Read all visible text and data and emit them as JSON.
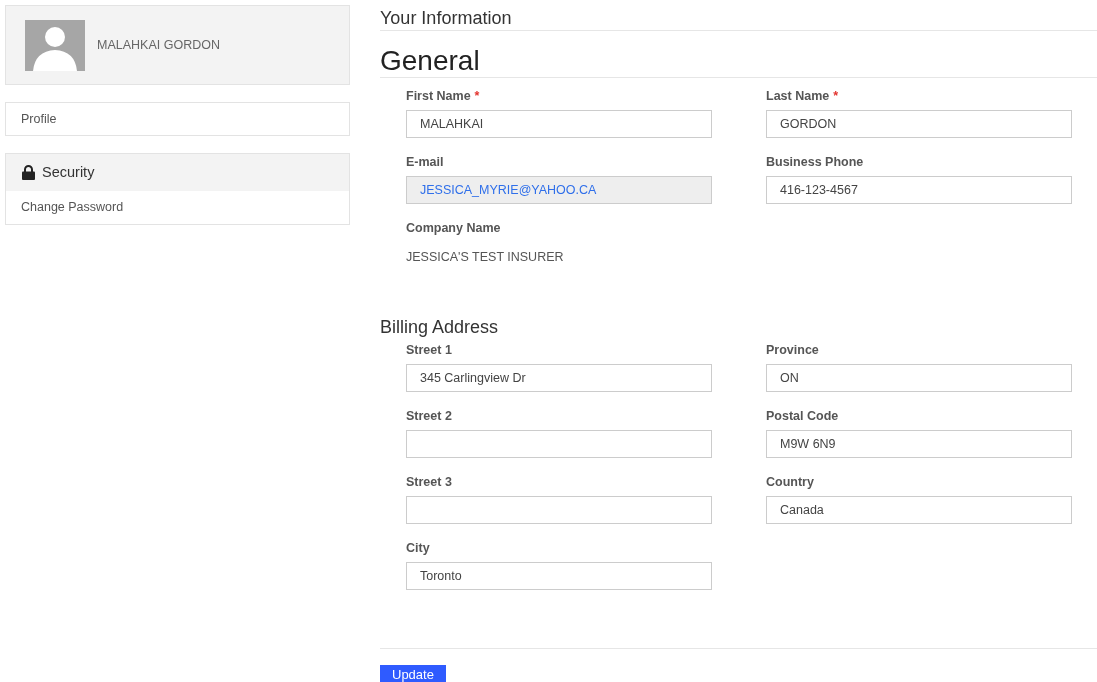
{
  "profile": {
    "name": "MALAHKAI GORDON"
  },
  "nav": [
    {
      "kind": "link",
      "label": "Profile"
    },
    {
      "kind": "group",
      "label": "Security",
      "items": [
        {
          "label": "Change Password"
        }
      ]
    }
  ],
  "page_title": "Your Information",
  "sections": [
    {
      "title": "General",
      "rows": [
        [
          {
            "label": "First Name",
            "required_mark": "*",
            "kind": "input",
            "value": "MALAHKAI",
            "disabled": false
          },
          {
            "label": "Last Name",
            "required_mark": "*",
            "kind": "input",
            "value": "GORDON",
            "disabled": false
          }
        ],
        [
          {
            "label": "E-mail",
            "kind": "input",
            "value": "JESSICA_MYRIE@YAHOO.CA",
            "disabled": true
          },
          {
            "label": "Business Phone",
            "kind": "input",
            "value": "416-123-4567",
            "disabled": false
          }
        ],
        [
          {
            "label": "Company Name",
            "kind": "text",
            "value": "JESSICA'S TEST INSURER"
          }
        ]
      ]
    },
    {
      "title": "Billing Address",
      "rows": [
        [
          {
            "label": "Street 1",
            "kind": "input",
            "value": "345 Carlingview Dr",
            "disabled": false
          },
          {
            "label": "Province",
            "kind": "input",
            "value": "ON",
            "disabled": false
          }
        ],
        [
          {
            "label": "Street 2",
            "kind": "input",
            "disabled": false
          },
          {
            "label": "Postal Code",
            "kind": "input",
            "value": "M9W 6N9",
            "disabled": false
          }
        ],
        [
          {
            "label": "Street 3",
            "kind": "input",
            "disabled": false
          },
          {
            "label": "Country",
            "kind": "input",
            "value": "Canada",
            "disabled": false
          }
        ],
        [
          {
            "label": "City",
            "kind": "input",
            "value": "Toronto",
            "disabled": false
          }
        ]
      ]
    }
  ],
  "submit": "Update"
}
